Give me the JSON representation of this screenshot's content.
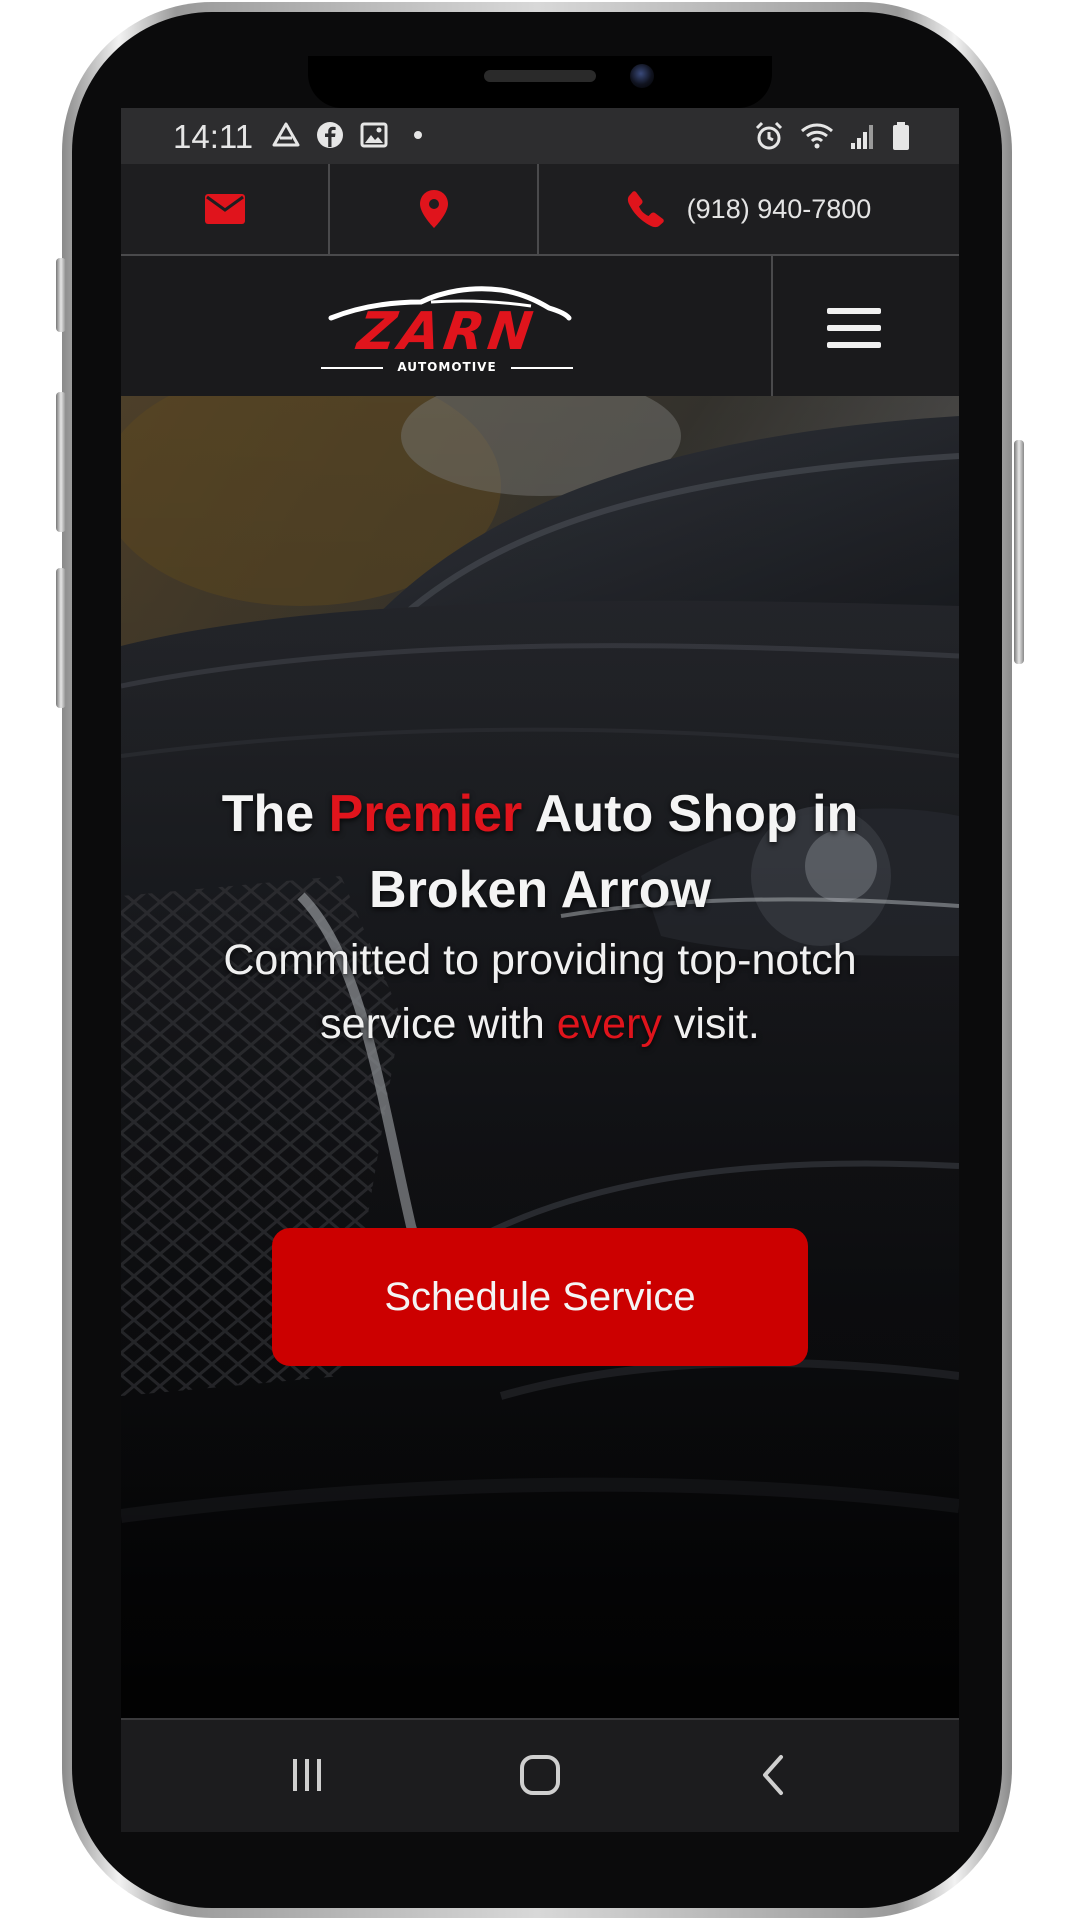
{
  "status_bar": {
    "time": "14:11",
    "left_icons": [
      "drive-icon",
      "facebook-icon",
      "gallery-icon",
      "dot-icon"
    ],
    "right_icons": [
      "alarm-icon",
      "wifi-icon",
      "signal-icon",
      "battery-icon"
    ]
  },
  "contact_bar": {
    "phone_number": "(918) 940-7800",
    "icons": [
      "email-icon",
      "location-pin-icon",
      "phone-icon"
    ],
    "accent_color": "#e0141c"
  },
  "header": {
    "logo_word": "ZARN",
    "logo_subtitle": "AUTOMOTIVE",
    "menu_icon": "hamburger-menu-icon"
  },
  "hero": {
    "title_part1": "The ",
    "title_highlight": "Premier",
    "title_part2": " Auto Shop in Broken Arrow",
    "subtitle_part1": "Committed to providing top-notch service with ",
    "subtitle_highlight": "every",
    "subtitle_part2": " visit.",
    "cta_label": "Schedule Service",
    "cta_color": "#cc0000"
  },
  "nav_bar": {
    "buttons": [
      "recent-apps-icon",
      "home-icon",
      "back-icon"
    ]
  }
}
